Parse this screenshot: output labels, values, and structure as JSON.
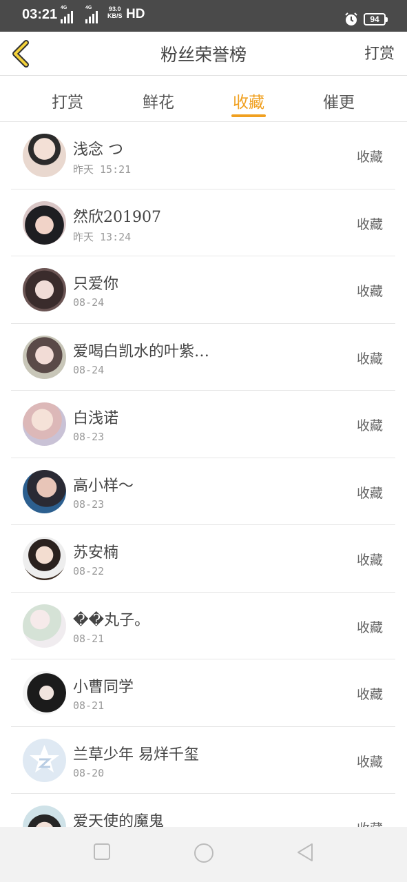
{
  "status_bar": {
    "time": "03:21",
    "net_type_1": "4G",
    "net_type_2": "4G",
    "speed_value": "93.0",
    "speed_unit": "KB/S",
    "hd": "HD",
    "battery": "94"
  },
  "header": {
    "title": "粉丝荣誉榜",
    "right_label": "打赏"
  },
  "tabs": [
    {
      "label": "打赏"
    },
    {
      "label": "鲜花"
    },
    {
      "label": "收藏"
    },
    {
      "label": "催更"
    }
  ],
  "active_tab": 2,
  "colors": {
    "accent": "#f0a020",
    "status_bar": "#4a4a4a"
  },
  "fans": [
    {
      "name": "浅念 つ",
      "date": "昨天 15:21",
      "action": "收藏"
    },
    {
      "name": "然欣201907",
      "date": "昨天 13:24",
      "action": "收藏"
    },
    {
      "name": "只爱你",
      "date": "08-24",
      "action": "收藏"
    },
    {
      "name": "爱喝白凯水的叶紫…",
      "date": "08-24",
      "action": "收藏"
    },
    {
      "name": "白浅诺",
      "date": "08-23",
      "action": "收藏"
    },
    {
      "name": "高小样～",
      "date": "08-23",
      "action": "收藏"
    },
    {
      "name": "苏安楠",
      "date": "08-22",
      "action": "收藏"
    },
    {
      "name": "��丸子。",
      "date": "08-21",
      "action": "收藏"
    },
    {
      "name": "小曹同学",
      "date": "08-21",
      "action": "收藏"
    },
    {
      "name": "兰草少年 易烊千玺",
      "date": "08-20",
      "action": "收藏"
    },
    {
      "name": "爱天使的魔鬼",
      "date": "",
      "action": "收藏"
    }
  ],
  "icons": {
    "back": "chevron-left-icon",
    "nav_recent": "square-icon",
    "nav_home": "circle-icon",
    "nav_back": "triangle-back-icon"
  }
}
